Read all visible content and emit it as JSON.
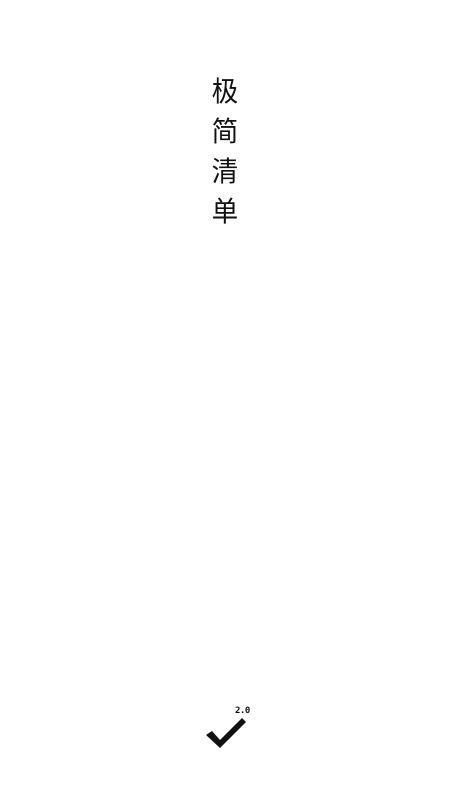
{
  "app": {
    "title_chars": [
      "极",
      "简",
      "清",
      "单"
    ],
    "logo_icon": "checkmark-icon",
    "version": "2.0",
    "background_color": "#ffffff",
    "text_color": "#111111"
  }
}
